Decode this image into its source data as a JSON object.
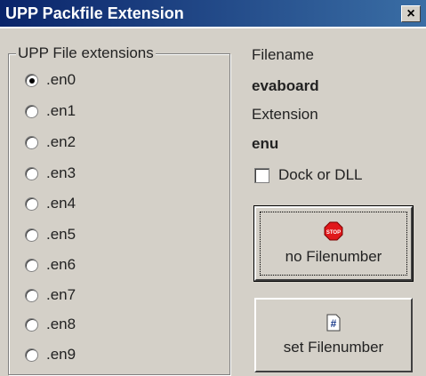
{
  "window": {
    "title": "UPP Packfile Extension",
    "close_label": "×"
  },
  "group": {
    "label": "UPP File extensions",
    "selected": ".en0",
    "options": [
      ".en0",
      ".en1",
      ".en2",
      ".en3",
      ".en4",
      ".en5",
      ".en6",
      ".en7",
      ".en8",
      ".en9"
    ]
  },
  "info": {
    "filename_label": "Filename",
    "filename_value": "evaboard",
    "extension_label": "Extension",
    "extension_value": "enu"
  },
  "dock": {
    "label": "Dock or DLL",
    "checked": false
  },
  "buttons": {
    "no_filenumber": {
      "label": "no Filenumber",
      "icon": "stop-icon",
      "icon_text": "STOP"
    },
    "set_filenumber": {
      "label": "set Filenumber",
      "icon": "hash-icon",
      "icon_text": "#"
    }
  },
  "colors": {
    "title_start": "#0a246a",
    "title_end": "#3a6ea5",
    "face": "#d4d0c8",
    "stop": "#e0181b"
  }
}
